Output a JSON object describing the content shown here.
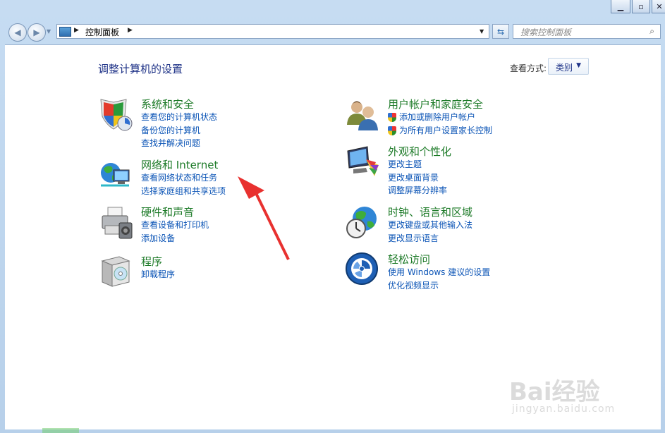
{
  "toolbar": {
    "address_path": [
      "控制面板"
    ],
    "search_placeholder": "搜索控制面板"
  },
  "page": {
    "title": "调整计算机的设置",
    "view_by_label": "查看方式:",
    "view_by_value": "类别"
  },
  "categories": [
    {
      "title": "系统和安全",
      "icon": "shield-icon",
      "links": [
        "查看您的计算机状态",
        "备份您的计算机",
        "查找并解决问题"
      ]
    },
    {
      "title": "网络和 Internet",
      "icon": "network-globe-icon",
      "links": [
        "查看网络状态和任务",
        "选择家庭组和共享选项"
      ]
    },
    {
      "title": "硬件和声音",
      "icon": "printer-icon",
      "links": [
        "查看设备和打印机",
        "添加设备"
      ]
    },
    {
      "title": "程序",
      "icon": "programs-box-icon",
      "links": [
        "卸载程序"
      ]
    },
    {
      "title": "用户帐户和家庭安全",
      "icon": "users-icon",
      "links": [
        "添加或删除用户帐户",
        "为所有用户设置家长控制"
      ]
    },
    {
      "title": "外观和个性化",
      "icon": "monitor-palette-icon",
      "links": [
        "更改主题",
        "更改桌面背景",
        "调整屏幕分辨率"
      ]
    },
    {
      "title": "时钟、语言和区域",
      "icon": "globe-clock-icon",
      "links": [
        "更改键盘或其他输入法",
        "更改显示语言"
      ]
    },
    {
      "title": "轻松访问",
      "icon": "accessibility-icon",
      "links": [
        "使用 Windows 建议的设置",
        "优化视频显示"
      ]
    }
  ],
  "watermark": {
    "text": "Bai经验",
    "sub": "jingyan.baidu.com"
  },
  "colors": {
    "link": "#0b54b6",
    "category_title": "#1c7a27",
    "heading": "#1e3287",
    "arrow": "#e8312f"
  }
}
